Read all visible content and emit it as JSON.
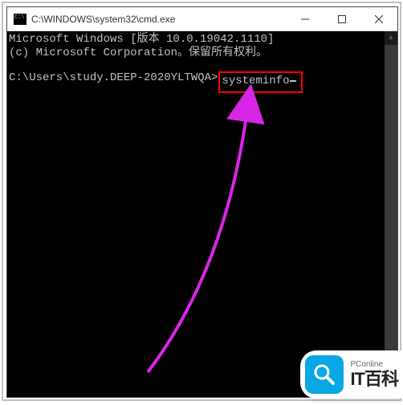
{
  "window": {
    "title": "C:\\WINDOWS\\system32\\cmd.exe"
  },
  "terminal": {
    "line1": "Microsoft Windows [版本 10.0.19042.1110]",
    "line2": "(c) Microsoft Corporation。保留所有权利。",
    "prompt": "C:\\Users\\study.DEEP-2020YLTWQA>",
    "command": "systeminfo"
  },
  "watermark": {
    "small": "PConline",
    "big": "IT百科"
  },
  "colors": {
    "highlight_border": "#ff0000",
    "arrow": "#d726e6",
    "brand": "#0aa7e5"
  }
}
